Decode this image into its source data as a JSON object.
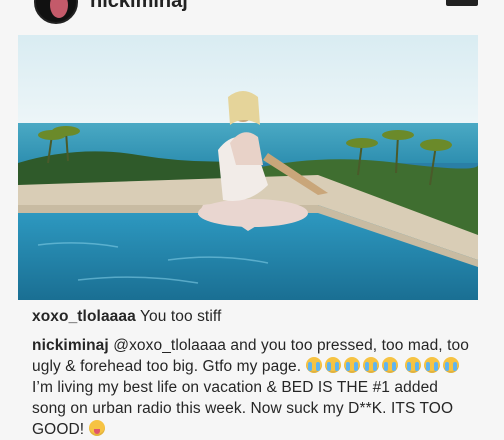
{
  "header": {
    "username": "nickiminaj"
  },
  "post": {
    "image_icon": "beach-pool-photo"
  },
  "comments": [
    {
      "user": "xoxo_tlolaaaa",
      "text": "You too stiff"
    },
    {
      "user": "nickiminaj",
      "text_1": "@xoxo_tlolaaaa and you too pressed, too mad, too ugly & forehead too big. Gtfo my page.",
      "emoji_run_1": "crying-laughing-emoji x5",
      "emoji_run_2": "crying-laughing-emoji x3",
      "text_2": "I’m living my best life on vacation & BED IS THE #1 added song on urban radio this week. Now suck my D**K. ITS TOO GOOD!",
      "emoji_end": "tongue-wink-emoji"
    }
  ]
}
